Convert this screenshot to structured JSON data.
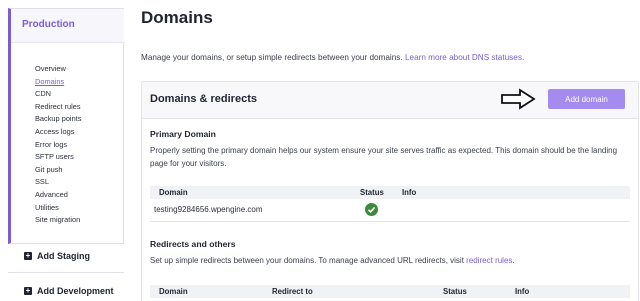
{
  "sidebar": {
    "environment": "Production",
    "nav_items": [
      {
        "label": "Overview"
      },
      {
        "label": "Domains"
      },
      {
        "label": "CDN"
      },
      {
        "label": "Redirect rules"
      },
      {
        "label": "Backup points"
      },
      {
        "label": "Access logs"
      },
      {
        "label": "Error logs"
      },
      {
        "label": "SFTP users"
      },
      {
        "label": "Git push"
      },
      {
        "label": "SSL"
      },
      {
        "label": "Advanced"
      },
      {
        "label": "Utilities"
      },
      {
        "label": "Site migration"
      }
    ],
    "active_item": "Domains",
    "add_staging": "Add Staging",
    "add_development": "Add Development"
  },
  "main": {
    "title": "Domains",
    "intro_text": "Manage your domains, or setup simple redirects between your domains.",
    "intro_link": "Learn more about DNS statuses",
    "intro_tail": "."
  },
  "card": {
    "title": "Domains & redirects",
    "add_button": "Add domain",
    "primary": {
      "title": "Primary Domain",
      "description": "Properly setting the primary domain helps our system ensure your site serves traffic as expected. This domain should be the landing page for your visitors.",
      "columns": {
        "domain": "Domain",
        "status": "Status",
        "info": "Info"
      },
      "rows": [
        {
          "domain": "testing9284656.wpengine.com",
          "status_icon": "check-circle-icon",
          "info": ""
        }
      ]
    },
    "redirects": {
      "title": "Redirects and others",
      "description": "Set up simple redirects between your domains. To manage advanced URL redirects, visit",
      "link": "redirect rules",
      "tail": ".",
      "columns": {
        "domain": "Domain",
        "redirect_to": "Redirect to",
        "status": "Status",
        "info": "Info"
      }
    }
  },
  "colors": {
    "accent": "#7b5cd6",
    "button": "#a48bf0",
    "success": "#3c8a3c"
  }
}
